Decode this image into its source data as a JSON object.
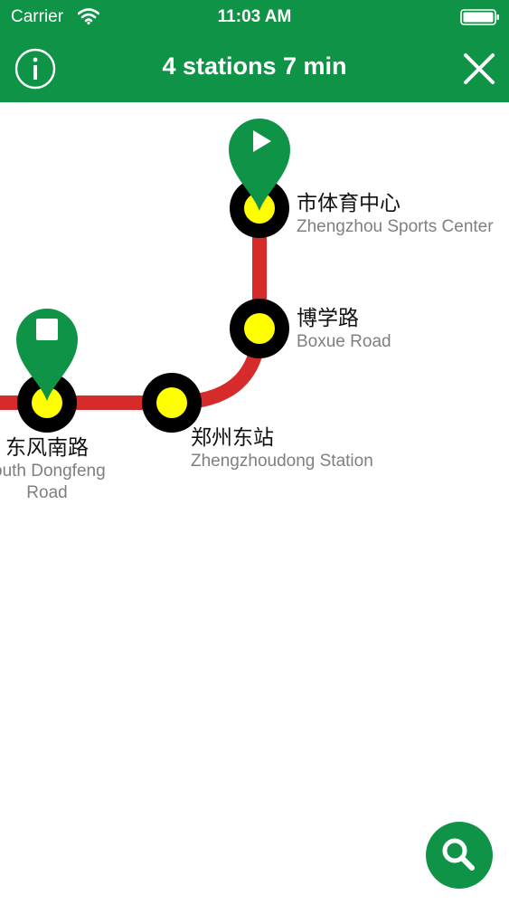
{
  "status_bar": {
    "carrier": "Carrier",
    "time": "11:03 AM",
    "wifi_icon": "wifi-icon",
    "battery_icon": "battery-icon"
  },
  "header": {
    "title": "4 stations 7 min",
    "info_icon": "info-icon",
    "close_icon": "close-icon",
    "background_color": "#0f9447"
  },
  "route": {
    "line_color": "#d52b2b",
    "station_fill": "#ffff00",
    "station_ring": "#000000",
    "stations": [
      {
        "name_zh": "市体育中心",
        "name_en": "Zhengzhou Sports Center",
        "marker": "start"
      },
      {
        "name_zh": "博学路",
        "name_en": "Boxue Road",
        "marker": ""
      },
      {
        "name_zh": "郑州东站",
        "name_en": "Zhengzhoudong Station",
        "marker": ""
      },
      {
        "name_zh": "东风南路",
        "name_en_line1": "outh Dongfeng",
        "name_en_line2": "Road",
        "marker": "end"
      }
    ],
    "start_marker_icon": "play-icon",
    "end_marker_icon": "stop-icon"
  },
  "search": {
    "icon": "search-icon",
    "color": "#0f9447"
  }
}
